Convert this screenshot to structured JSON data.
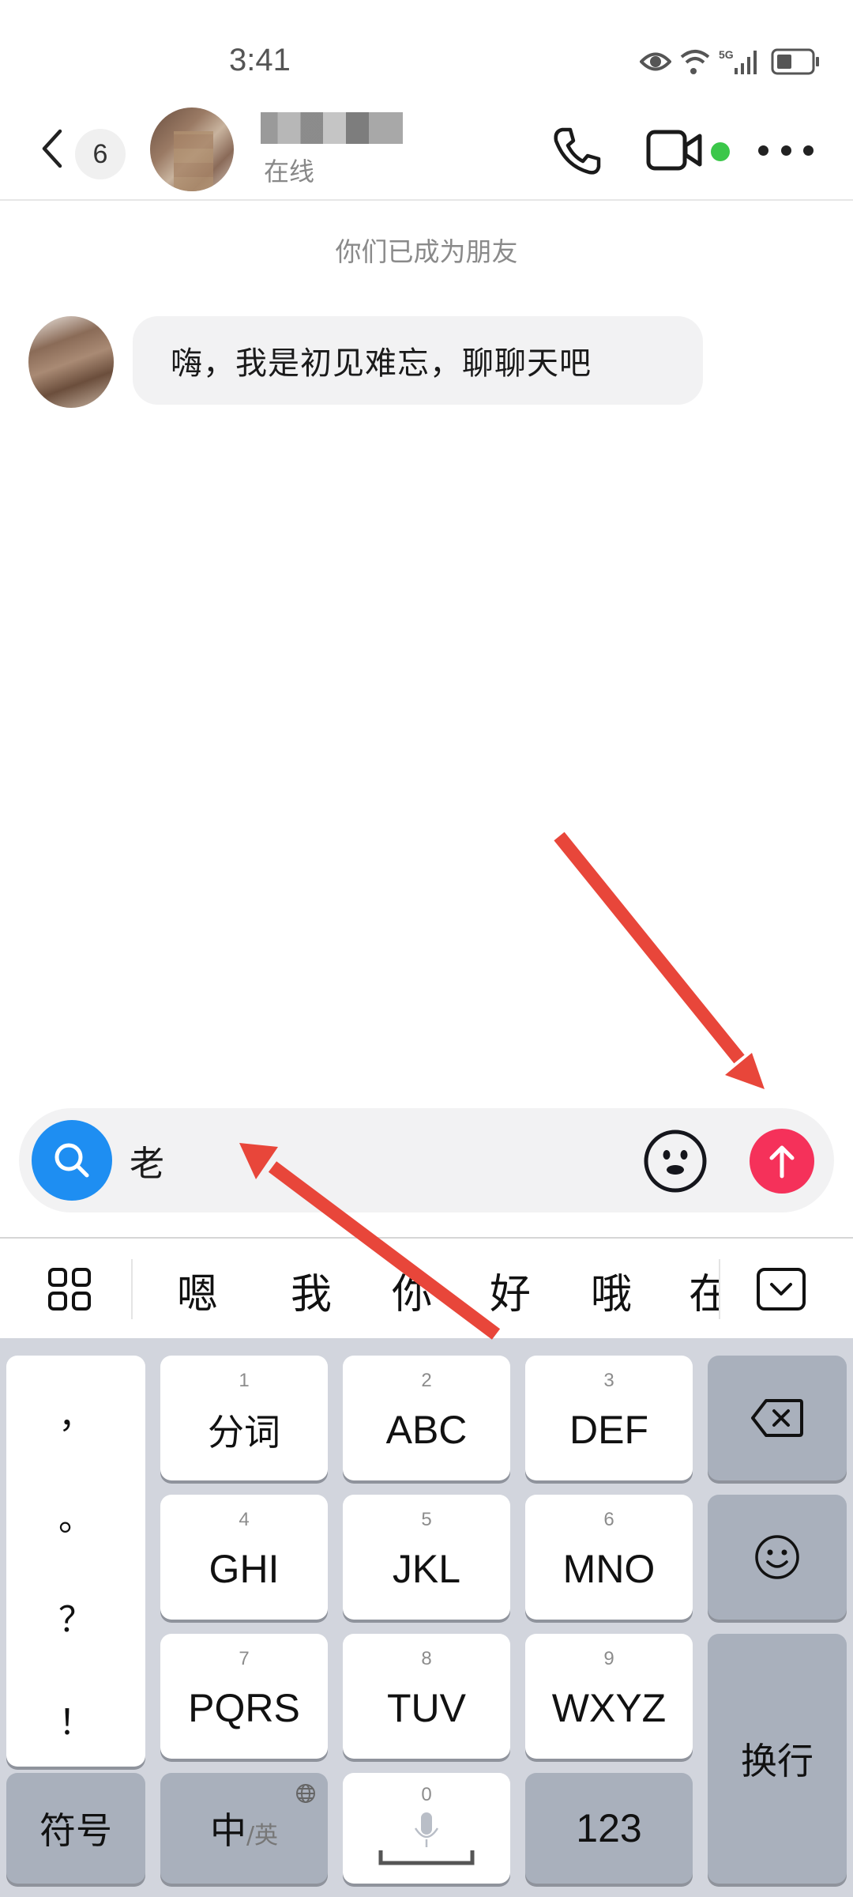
{
  "status_bar": {
    "time": "3:41",
    "icons": [
      "eye-comfort-icon",
      "wifi-icon",
      "5g-signal-icon",
      "battery-icon"
    ],
    "network_label": "5G"
  },
  "header": {
    "back_icon": "chevron-left-icon",
    "unread_count": "6",
    "contact_status": "在线",
    "actions": [
      "phone-icon",
      "video-call-icon",
      "more-icon"
    ],
    "online_color": "#3bc74a"
  },
  "chat": {
    "system_note": "你们已成为朋友",
    "messages": [
      {
        "from": "contact",
        "text": "嗨，我是初见难忘，聊聊天吧"
      }
    ]
  },
  "input_bar": {
    "value": "老",
    "search_icon": "search-icon",
    "emoji_icon": "emoji-icon",
    "send_icon": "send-arrow-up-icon",
    "search_color": "#1e8ef2",
    "send_color": "#f5315a"
  },
  "candidates": {
    "items": [
      "嗯",
      "我",
      "你",
      "好",
      "哦",
      "在"
    ],
    "menu_icon": "grid-menu-icon",
    "collapse_icon": "collapse-keyboard-icon"
  },
  "keyboard": {
    "punctuation": [
      "，",
      "。",
      "？",
      "！"
    ],
    "keys": [
      {
        "num": "1",
        "label": "分词"
      },
      {
        "num": "2",
        "label": "ABC"
      },
      {
        "num": "3",
        "label": "DEF"
      },
      {
        "num": "4",
        "label": "GHI"
      },
      {
        "num": "5",
        "label": "JKL"
      },
      {
        "num": "6",
        "label": "MNO"
      },
      {
        "num": "7",
        "label": "PQRS"
      },
      {
        "num": "8",
        "label": "TUV"
      },
      {
        "num": "9",
        "label": "WXYZ"
      }
    ],
    "symbols_label": "符号",
    "lang_main": "中",
    "lang_alt": "/英",
    "space_num": "0",
    "numbers_label": "123",
    "newline_label": "换行",
    "backspace_icon": "backspace-icon",
    "emoji_icon": "smiley-icon",
    "mic_icon": "microphone-icon",
    "globe_icon": "globe-icon"
  },
  "annotations": {
    "arrow_color": "#e8463a",
    "arrows": [
      "arrow-to-send-button",
      "arrow-to-input-field"
    ]
  }
}
